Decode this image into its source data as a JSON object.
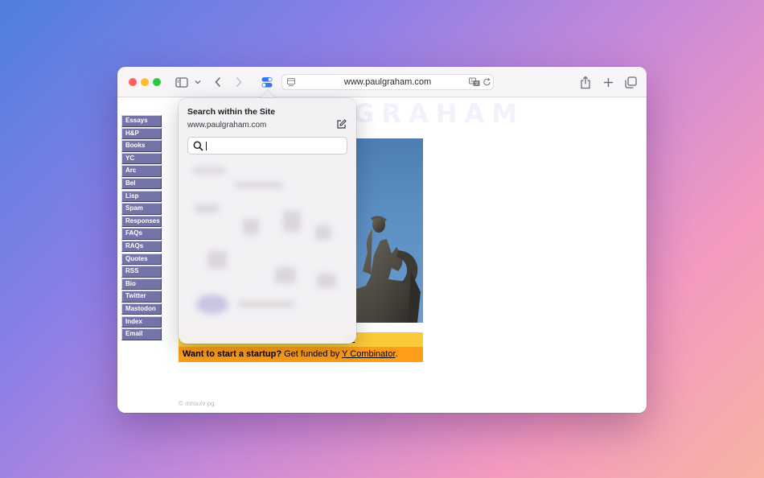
{
  "browser": {
    "url": "www.paulgraham.com"
  },
  "site": {
    "banner_title": "GRAHAM",
    "nav": [
      "Essays",
      "H&P",
      "Books",
      "YC",
      "Arc",
      "Bel",
      "Lisp",
      "Spam",
      "Responses",
      "FAQs",
      "RAQs",
      "Quotes",
      "RSS",
      "Bio",
      "Twitter",
      "Mastodon",
      "Index",
      "Email"
    ],
    "yellow_link": "de",
    "startup_bold": "Want to start a startup?",
    "startup_text": " Get funded by ",
    "startup_link": "Y Combinator",
    "startup_end": ".",
    "footer": "© mmxxv pg"
  },
  "popover": {
    "title": "Search within the Site",
    "site": "www.paulgraham.com",
    "search_value": "",
    "search_placeholder": ""
  },
  "icons": {
    "sidebar": "sidebar-icon",
    "chevron": "chevron-down-icon",
    "back": "chevron-left-icon",
    "forward": "chevron-right-icon",
    "extension": "extension-toggle-icon",
    "share": "share-icon",
    "new_tab": "plus-icon",
    "tabs": "tab-overview-icon",
    "translate": "translate-icon",
    "reload": "reload-icon",
    "edit": "edit-icon",
    "search": "search-icon"
  },
  "colors": {
    "nav_bg": "#7474a8",
    "yellow_band": "#fbca3a",
    "orange_band": "#ff9e1b",
    "extension_accent": "#3478f6"
  }
}
